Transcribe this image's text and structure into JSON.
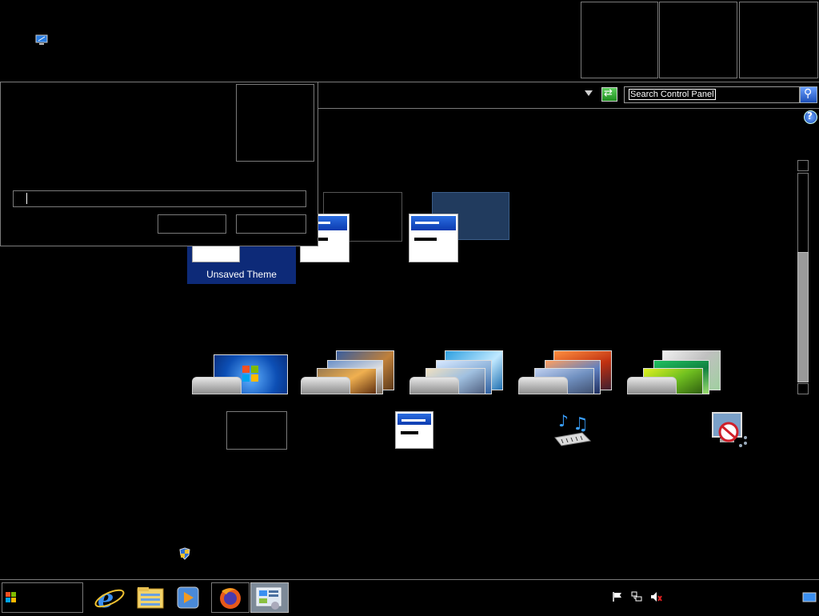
{
  "desktop": {
    "icon": "computer-icon"
  },
  "top_buttons": [
    "",
    "",
    ""
  ],
  "address_bar": {
    "dropdown_icon": "chevron-down-icon",
    "refresh_icon": "refresh-icon",
    "search_placeholder": "Search Control Panel",
    "search_icon": "search-icon",
    "help_icon": "help-icon"
  },
  "dialog": {
    "input_value": "",
    "ok_label": "",
    "cancel_label": ""
  },
  "themes": {
    "my_themes": [
      {
        "label": "Unsaved Theme",
        "selected": true
      },
      {
        "label": ""
      },
      {
        "label": ""
      }
    ],
    "installed": [
      {
        "name": "windows-7"
      },
      {
        "name": "architecture"
      },
      {
        "name": "characters"
      },
      {
        "name": "landscapes"
      },
      {
        "name": "nature"
      }
    ]
  },
  "bottom_links": [
    {
      "icon": "desktop-background-icon",
      "label": ""
    },
    {
      "icon": "window-color-icon",
      "label": ""
    },
    {
      "icon": "sounds-icon",
      "label": ""
    },
    {
      "icon": "screen-saver-icon",
      "label": ""
    }
  ],
  "taskbar": {
    "start_icon": "windows-logo-icon",
    "pinned": [
      "internet-explorer-icon",
      "file-explorer-icon",
      "media-player-icon",
      "firefox-icon",
      "control-panel-icon"
    ],
    "tray": [
      "action-center-flag-icon",
      "network-icon",
      "volume-muted-icon",
      "show-desktop-icon"
    ]
  },
  "colors": {
    "selected_theme_bg": "#0d2a78",
    "high_contrast_theme": "#213b5e"
  }
}
